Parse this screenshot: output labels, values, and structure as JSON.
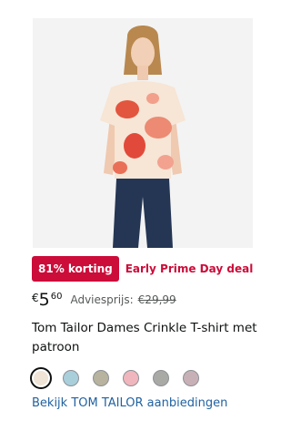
{
  "product": {
    "discount_badge": "81% korting",
    "deal_label": "Early Prime Day deal",
    "price": {
      "symbol": "€",
      "whole": "5",
      "fraction": "60",
      "list_label": "Adviesprijs:",
      "list_price": "€29,99"
    },
    "title": "Tom Tailor Dames Crinkle T-shirt met patroon",
    "swatches": [
      {
        "color": "#efe4d6",
        "selected": true
      },
      {
        "color": "#a9cfdb",
        "selected": false
      },
      {
        "color": "#b7b39e",
        "selected": false
      },
      {
        "color": "#f0b6bd",
        "selected": false
      },
      {
        "color": "#a9aaa6",
        "selected": false
      },
      {
        "color": "#c8b1b6",
        "selected": false
      }
    ],
    "brand_link": "Bekijk TOM TAILOR aanbiedingen"
  }
}
